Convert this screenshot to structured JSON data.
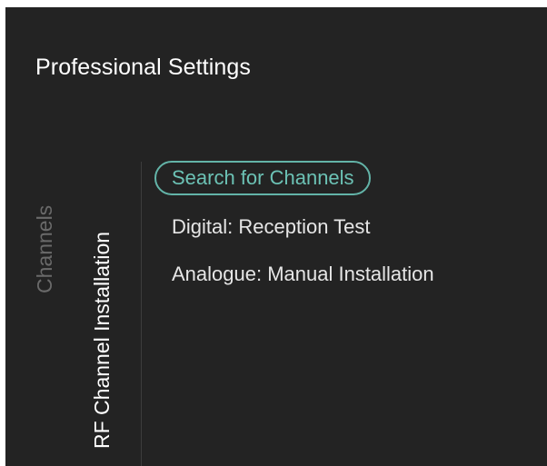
{
  "page": {
    "title": "Professional Settings"
  },
  "breadcrumb": {
    "parent": "Channels",
    "current": "RF Channel Installation"
  },
  "menu": {
    "items": [
      {
        "label": "Search for Channels",
        "selected": true
      },
      {
        "label": "Digital: Reception Test",
        "selected": false
      },
      {
        "label": "Analogue: Manual Installation",
        "selected": false
      }
    ]
  },
  "colors": {
    "background": "#232323",
    "accent": "#63b4a8",
    "text_primary": "#e6e6e6",
    "text_dim": "#6a6a6a"
  }
}
